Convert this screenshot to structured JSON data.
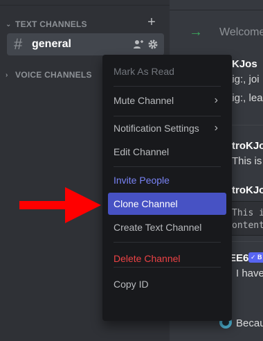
{
  "sidebar": {
    "categories": {
      "text": "TEXT CHANNELS",
      "voice": "VOICE CHANNELS"
    },
    "channels": [
      {
        "name": "general",
        "icon": "hash-icon",
        "selected": true
      }
    ]
  },
  "chat": {
    "welcome": "Welcome",
    "messages": [
      {
        "author_fragment": "troKJos",
        "lines": [
          "aig:, joi",
          "aig:, lea"
        ]
      },
      {
        "author_fragment": "troKJos",
        "lines": [
          "This is a"
        ]
      },
      {
        "author_fragment": "troKJos",
        "code_lines": [
          "This i",
          "ontent"
        ]
      },
      {
        "author_fragment": "EE6",
        "badge": "B",
        "lines": [
          "I have"
        ]
      },
      {
        "author_fragment": "",
        "lines": [
          "Becau"
        ]
      }
    ]
  },
  "context_menu": {
    "items": [
      {
        "label": "Mark As Read",
        "state": "disabled"
      },
      {
        "label": "Mute Channel",
        "submenu": true
      },
      {
        "label": "Notification Settings",
        "submenu": true
      },
      {
        "label": "Edit Channel"
      },
      {
        "label": "Invite People",
        "state": "accent"
      },
      {
        "label": "Clone Channel",
        "state": "active"
      },
      {
        "label": "Create Text Channel"
      },
      {
        "label": "Delete Channel",
        "state": "danger"
      },
      {
        "label": "Copy ID"
      }
    ]
  },
  "colors": {
    "sidebar_bg": "#2f3136",
    "chat_bg": "#36393f",
    "menu_bg": "#18191c",
    "active_item": "#4752c4",
    "accent": "#7983f5",
    "danger": "#ed4245",
    "annotation_arrow": "#ff0000"
  }
}
